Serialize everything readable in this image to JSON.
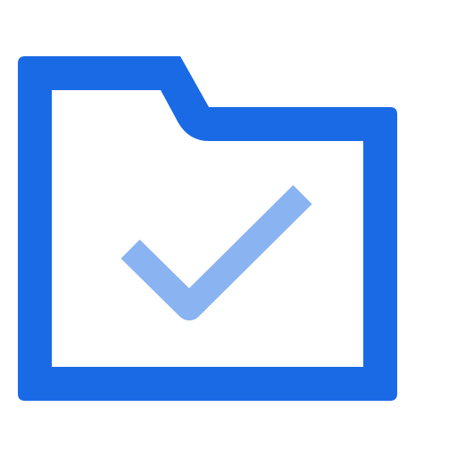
{
  "icon": {
    "name": "folder-check-icon",
    "colors": {
      "folder": "#1a6ae6",
      "check": "#8ab3f1",
      "background": "#ffffff"
    }
  }
}
